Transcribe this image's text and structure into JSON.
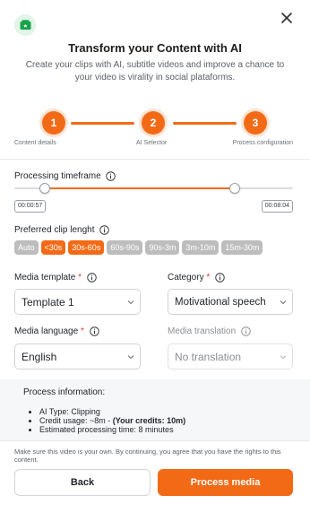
{
  "modal": {
    "title": "Transform your Content with AI",
    "subtitle": "Create your clips with AI, subtitle videos and improve a chance to your video is virality in social plataforms."
  },
  "stepper": {
    "steps": [
      {
        "number": "1",
        "label": "Content details"
      },
      {
        "number": "2",
        "label": "AI Selector"
      },
      {
        "number": "3",
        "label": "Process configuration"
      }
    ]
  },
  "timeframe": {
    "label": "Processing timeframe",
    "start": "00:00:57",
    "end": "00:08:04",
    "start_fraction": 0.11,
    "end_fraction": 0.79
  },
  "clip_length": {
    "label": "Preferred clip lenght",
    "options": [
      {
        "label": "Auto",
        "active": false
      },
      {
        "label": "<30s",
        "active": true
      },
      {
        "label": "30s-60s",
        "active": true
      },
      {
        "label": "60s-90s",
        "active": false
      },
      {
        "label": "90s-3m",
        "active": false
      },
      {
        "label": "3m-10m",
        "active": false
      },
      {
        "label": "15m-30m",
        "active": false
      }
    ]
  },
  "media_template": {
    "label": "Media template",
    "required": "*",
    "value": "Template 1"
  },
  "category": {
    "label": "Category",
    "required": "*",
    "value": "Motivational speech"
  },
  "media_language": {
    "label": "Media language",
    "required": "*",
    "value": "English"
  },
  "media_translation": {
    "label": "Media translation",
    "value": "No translation"
  },
  "process_info": {
    "title": "Process information:",
    "ai_type": "AI Type: Clipping",
    "credit_usage": "Credit usage: ~8m - ",
    "credits": "(Your credits:  10m)",
    "estimated_time": "Estimated processing time: 8 minutes"
  },
  "footnote": "Make sure this video is your own. By continuing, you agree that you have the rights to this content.",
  "buttons": {
    "back": "Back",
    "process": "Process media"
  },
  "colors": {
    "accent": "#f36a16",
    "chip_inactive": "#bdbdbd",
    "logo_green": "#16a34a"
  }
}
